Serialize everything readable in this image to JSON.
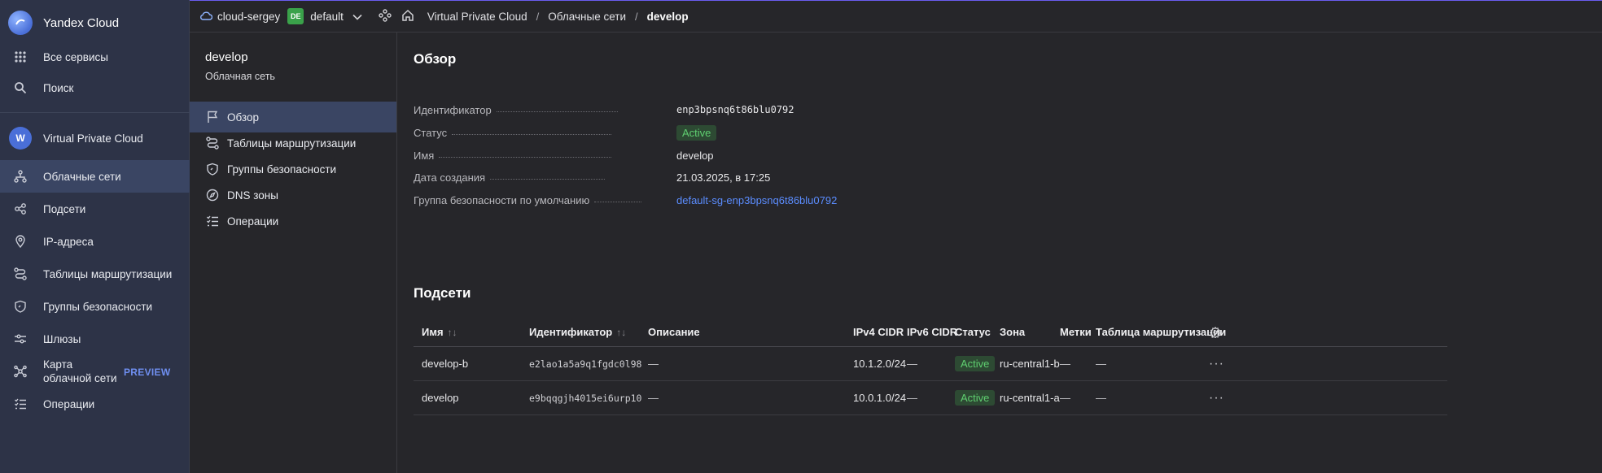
{
  "brand": {
    "name": "Yandex Cloud"
  },
  "sidebar": {
    "top_items": [
      {
        "label": "Все сервисы",
        "icon": "grid-icon"
      },
      {
        "label": "Поиск",
        "icon": "search-icon"
      }
    ],
    "service": {
      "label": "Virtual Private Cloud",
      "badge": "W"
    },
    "items": [
      {
        "label": "Облачные сети",
        "icon": "network-icon",
        "active": true
      },
      {
        "label": "Подсети",
        "icon": "subnets-icon"
      },
      {
        "label": "IP-адреса",
        "icon": "location-icon"
      },
      {
        "label": "Таблицы маршрутизации",
        "icon": "route-icon"
      },
      {
        "label": "Группы безопасности",
        "icon": "shield-icon"
      },
      {
        "label": "Шлюзы",
        "icon": "gateway-icon"
      },
      {
        "label_line1": "Карта",
        "label_line2": "облачной сети",
        "icon": "map-icon",
        "badge": "PREVIEW"
      },
      {
        "label": "Операции",
        "icon": "operations-icon"
      }
    ]
  },
  "topbar": {
    "cloud": "cloud-sergey",
    "folder_badge": "DE",
    "folder": "default",
    "breadcrumbs": [
      "Virtual Private Cloud",
      "Облачные сети",
      "develop"
    ],
    "separator": "/"
  },
  "subpanel": {
    "title": "develop",
    "subtitle": "Облачная сеть",
    "items": [
      {
        "label": "Обзор",
        "icon": "flag-icon",
        "active": true
      },
      {
        "label": "Таблицы маршрутизации",
        "icon": "route-icon"
      },
      {
        "label": "Группы безопасности",
        "icon": "shield-icon"
      },
      {
        "label": "DNS зоны",
        "icon": "dns-icon"
      },
      {
        "label": "Операции",
        "icon": "operations-icon"
      }
    ]
  },
  "overview": {
    "heading": "Обзор",
    "fields": [
      {
        "key": "Идентификатор",
        "value": "enp3bpsnq6t86blu0792"
      },
      {
        "key": "Статус",
        "value": "Active"
      },
      {
        "key": "Имя",
        "value": "develop"
      },
      {
        "key": "Дата создания",
        "value": "21.03.2025, в 17:25"
      },
      {
        "key": "Группа безопасности по умолчанию",
        "value": "default-sg-enp3bpsnq6t86blu0792"
      }
    ]
  },
  "subnets": {
    "heading": "Подсети",
    "columns": [
      "Имя",
      "Идентификатор",
      "Описание",
      "IPv4 CIDR",
      "IPv6 CIDR",
      "Статус",
      "Зона",
      "Метки",
      "Таблица маршрутизации"
    ],
    "rows": [
      {
        "name": "develop-b",
        "id": "e2lao1a5a9q1fgdc0l98",
        "description": "—",
        "ipv4": "10.1.2.0/24",
        "ipv6": "—",
        "status": "Active",
        "zone": "ru-central1-b",
        "labels": "—",
        "route_table": "—"
      },
      {
        "name": "develop",
        "id": "e9bqqgjh4015ei6urp10",
        "description": "—",
        "ipv4": "10.0.1.0/24",
        "ipv6": "—",
        "status": "Active",
        "zone": "ru-central1-a",
        "labels": "—",
        "route_table": "—"
      }
    ],
    "row_menu": "···",
    "sort_icon": "↑↓"
  },
  "colors": {
    "accent": "#5b8dff",
    "active_status": "#5fcf70",
    "sidebar_bg": "#2d3347",
    "active_item": "#3a4563"
  }
}
